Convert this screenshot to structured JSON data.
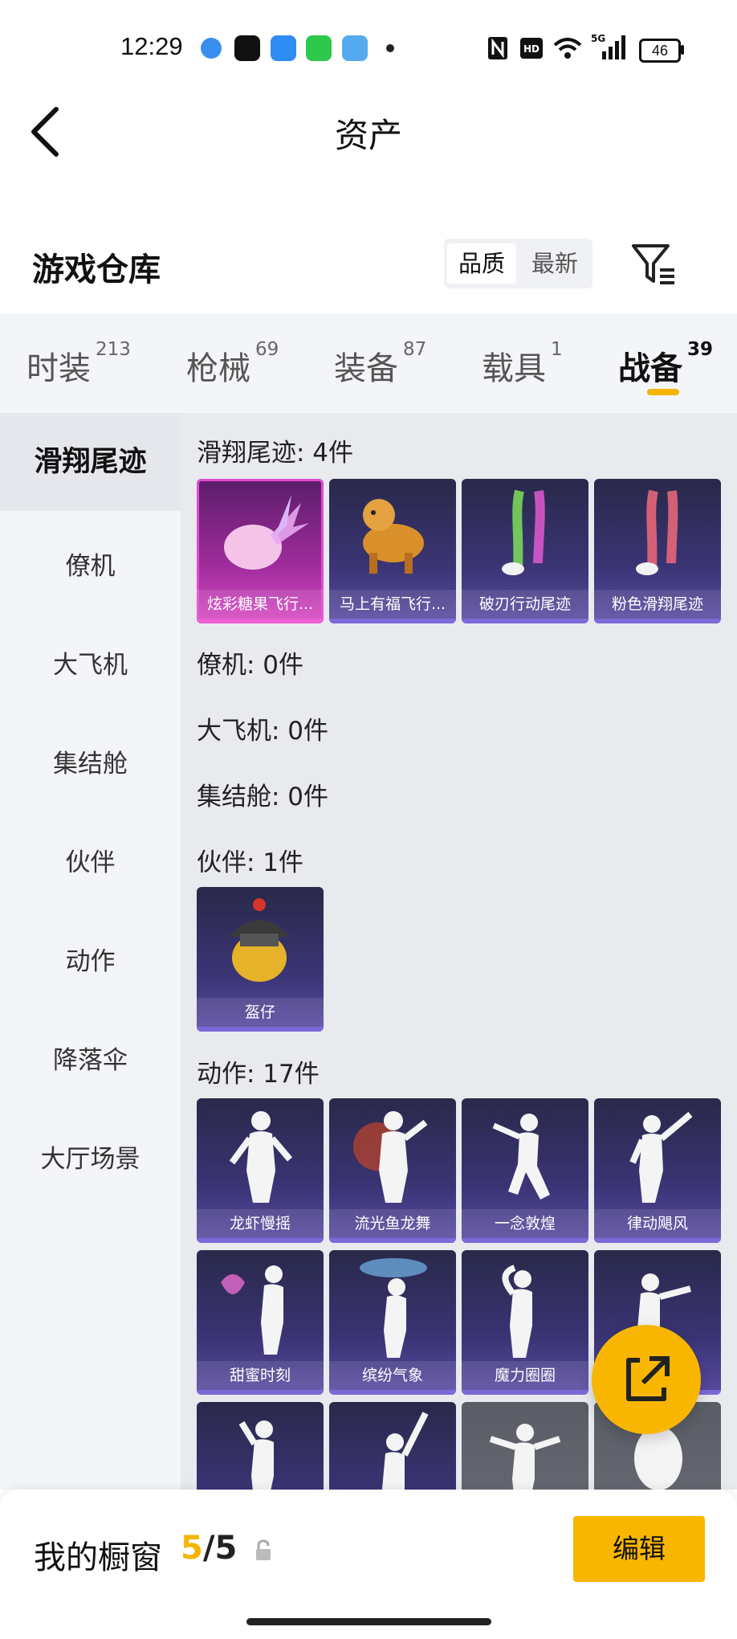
{
  "status_bar": {
    "time": "12:29",
    "battery": "46",
    "network": "5G"
  },
  "header": {
    "title": "资产"
  },
  "section": {
    "title": "游戏仓库",
    "sort_options": [
      "品质",
      "最新"
    ]
  },
  "tabs": [
    {
      "label": "时装",
      "count": "213"
    },
    {
      "label": "枪械",
      "count": "69"
    },
    {
      "label": "装备",
      "count": "87"
    },
    {
      "label": "载具",
      "count": "1"
    },
    {
      "label": "战备",
      "count": "39"
    }
  ],
  "sidebar": [
    {
      "label": "滑翔尾迹"
    },
    {
      "label": "僚机"
    },
    {
      "label": "大飞机"
    },
    {
      "label": "集结舱"
    },
    {
      "label": "伙伴"
    },
    {
      "label": "动作"
    },
    {
      "label": "降落伞"
    },
    {
      "label": "大厅场景"
    }
  ],
  "groups": [
    {
      "title": "滑翔尾迹: 4件",
      "items": [
        "炫彩糖果飞行...",
        "马上有福飞行...",
        "破刃行动尾迹",
        "粉色滑翔尾迹"
      ]
    },
    {
      "title": "僚机: 0件",
      "items": []
    },
    {
      "title": "大飞机: 0件",
      "items": []
    },
    {
      "title": "集结舱: 0件",
      "items": []
    },
    {
      "title": "伙伴: 1件",
      "items": [
        "盔仔"
      ]
    },
    {
      "title": "动作: 17件",
      "items": [
        "龙虾慢摇",
        "流光鱼龙舞",
        "一念敦煌",
        "律动飓风",
        "甜蜜时刻",
        "缤纷气象",
        "魔力圈圈"
      ]
    }
  ],
  "bottom": {
    "label": "我的橱窗",
    "count_current": "5",
    "count_sep": "/",
    "count_total": "5",
    "edit_label": "编辑"
  },
  "colors": {
    "accent": "#f8b600",
    "card_purple": "#3a3474",
    "card_pink": "#a02c9c"
  }
}
